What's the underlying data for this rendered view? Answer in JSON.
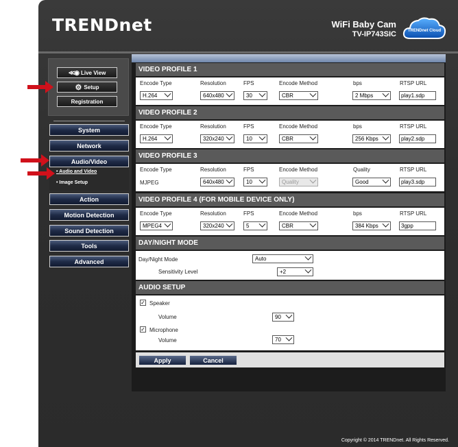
{
  "header": {
    "brand": "TRENDnet",
    "product": "WiFi Baby Cam",
    "model": "TV-IP743SIC",
    "cloud_logo": "TRENDnet Cloud"
  },
  "quick_buttons": {
    "live_view": "Live View",
    "setup": "Setup",
    "registration": "Registration"
  },
  "nav": {
    "system": "System",
    "network": "Network",
    "audio_video": "Audio/Video",
    "submenu": [
      "Audio and Video",
      "Image Setup"
    ],
    "action": "Action",
    "motion_detection": "Motion Detection",
    "sound_detection": "Sound Detection",
    "tools": "Tools",
    "advanced": "Advanced"
  },
  "profiles": [
    {
      "title": "VIDEO PROFILE 1",
      "cols": [
        "Encode Type",
        "Resolution",
        "FPS",
        "Encode Method",
        "bps",
        "RTSP URL"
      ],
      "encode_type": "H.264",
      "resolution": "640x480",
      "fps": "30",
      "encode_method": "CBR",
      "rate": "2 Mbps",
      "rtsp": "play1.sdp"
    },
    {
      "title": "VIDEO PROFILE 2",
      "cols": [
        "Encode Type",
        "Resolution",
        "FPS",
        "Encode Method",
        "bps",
        "RTSP URL"
      ],
      "encode_type": "H.264",
      "resolution": "320x240",
      "fps": "10",
      "encode_method": "CBR",
      "rate": "256 Kbps",
      "rtsp": "play2.sdp"
    },
    {
      "title": "VIDEO PROFILE 3",
      "cols": [
        "Encode Type",
        "Resolution",
        "FPS",
        "Encode Method",
        "Quality",
        "RTSP URL"
      ],
      "encode_type": "MJPEG",
      "resolution": "640x480",
      "fps": "10",
      "encode_method": "Quality",
      "rate": "Good",
      "rtsp": "play3.sdp"
    },
    {
      "title": "VIDEO PROFILE 4 (FOR MOBILE DEVICE ONLY)",
      "cols": [
        "Encode Type",
        "Resolution",
        "FPS",
        "Encode Method",
        "bps",
        "RTSP URL"
      ],
      "encode_type": "MPEG4",
      "resolution": "320x240",
      "fps": "5",
      "encode_method": "CBR",
      "rate": "384 Kbps",
      "rtsp": "3gpp"
    }
  ],
  "day_night": {
    "title": "DAY/NIGHT MODE",
    "mode_label": "Day/Night Mode",
    "mode_value": "Auto",
    "sensitivity_label": "Sensitivity Level",
    "sensitivity_value": "+2"
  },
  "audio": {
    "title": "AUDIO SETUP",
    "speaker_label": "Speaker",
    "speaker_checked": true,
    "volume_label": "Volume",
    "speaker_volume": "90",
    "mic_label": "Microphone",
    "mic_checked": true,
    "mic_volume": "70"
  },
  "actions": {
    "apply": "Apply",
    "cancel": "Cancel"
  },
  "footer": {
    "copyright": "Copyright © 2014 TRENDnet. All Rights Reserved."
  },
  "colors": {
    "arrow": "#d0111b",
    "nav_dark": "#1f2b47",
    "section_header": "#5a5a5a"
  }
}
